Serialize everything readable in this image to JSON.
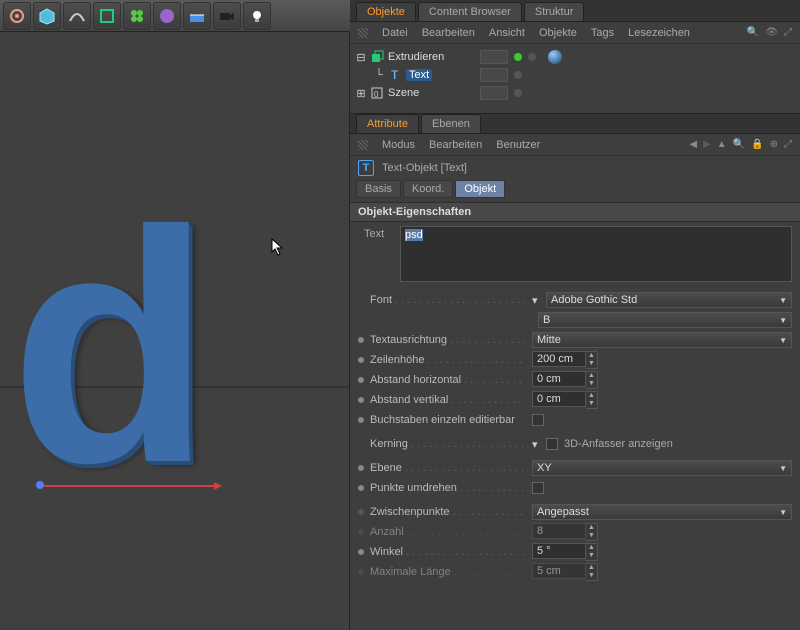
{
  "toolbar_icons": [
    "gear",
    "cube",
    "spline",
    "deformer",
    "cloner",
    "sphere",
    "floor",
    "camera",
    "light"
  ],
  "panel": {
    "tabs": [
      "Objekte",
      "Content Browser",
      "Struktur"
    ],
    "active_tab": 0,
    "menu": [
      "Datei",
      "Bearbeiten",
      "Ansicht",
      "Objekte",
      "Tags",
      "Lesezeichen"
    ]
  },
  "tree": {
    "items": [
      {
        "name": "Extrudieren",
        "icon": "extrude",
        "selected": false,
        "has_tag": true
      },
      {
        "name": "Text",
        "icon": "text",
        "selected": true
      },
      {
        "name": "Szene",
        "icon": "layer",
        "selected": false
      }
    ]
  },
  "attr_tabs": [
    "Attribute",
    "Ebenen"
  ],
  "attr_active": 0,
  "attr_menu": [
    "Modus",
    "Bearbeiten",
    "Benutzer"
  ],
  "object_title": "Text-Objekt [Text]",
  "subtabs": [
    "Basis",
    "Koord.",
    "Objekt"
  ],
  "subtab_active": 2,
  "group_title": "Objekt-Eigenschaften",
  "props": {
    "text_label": "Text",
    "text_value": "psd",
    "font_label": "Font",
    "font_value": "Adobe Gothic Std",
    "font_weight": "B",
    "align_label": "Textausrichtung",
    "align_value": "Mitte",
    "lineheight_label": "Zeilenhöhe",
    "lineheight_value": "200 cm",
    "hspace_label": "Abstand horizontal",
    "hspace_value": "0 cm",
    "vspace_label": "Abstand vertikal",
    "vspace_value": "0 cm",
    "letters_label": "Buchstaben einzeln editierbar",
    "kerning_label": "Kerning",
    "show3d_label": "3D-Anfasser anzeigen",
    "plane_label": "Ebene",
    "plane_value": "XY",
    "reverse_label": "Punkte umdrehen",
    "inter_label": "Zwischenpunkte",
    "inter_value": "Angepasst",
    "count_label": "Anzahl",
    "count_value": "8",
    "angle_label": "Winkel",
    "angle_value": "5 °",
    "maxlen_label": "Maximale Länge",
    "maxlen_value": "5 cm"
  }
}
